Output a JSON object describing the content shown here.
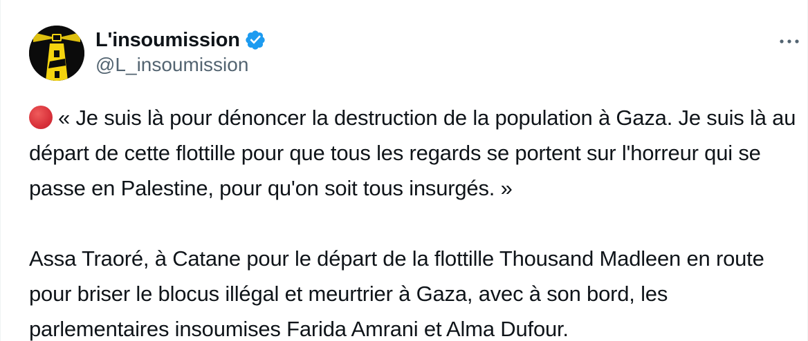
{
  "author": {
    "display_name": "L'insoumission",
    "handle": "@L_insoumission",
    "verified": true,
    "avatar_icon": "lighthouse-logo",
    "verified_icon": "verified-badge-icon",
    "verified_color": "#1d9bf0"
  },
  "more_icon": "more-options-icon",
  "tweet": {
    "emoji": "red-circle",
    "quote": "« Je suis là pour dénoncer la destruction de la population à Gaza. Je suis là au départ de cette flottille pour que tous les regards se portent sur l'horreur qui se passe en Palestine, pour qu'on soit tous insurgés. »",
    "caption": "Assa Traoré, à Catane pour le départ de la flottille Thousand Madleen en route pour briser le blocus illégal et meurtrier à Gaza, avec à son bord, les parlementaires insoumises Farida Amrani et Alma Dufour."
  },
  "colors": {
    "text_primary": "#0f1419",
    "text_secondary": "#536471",
    "emoji_red": "#d8313a",
    "avatar_yellow": "#f5d40f"
  }
}
